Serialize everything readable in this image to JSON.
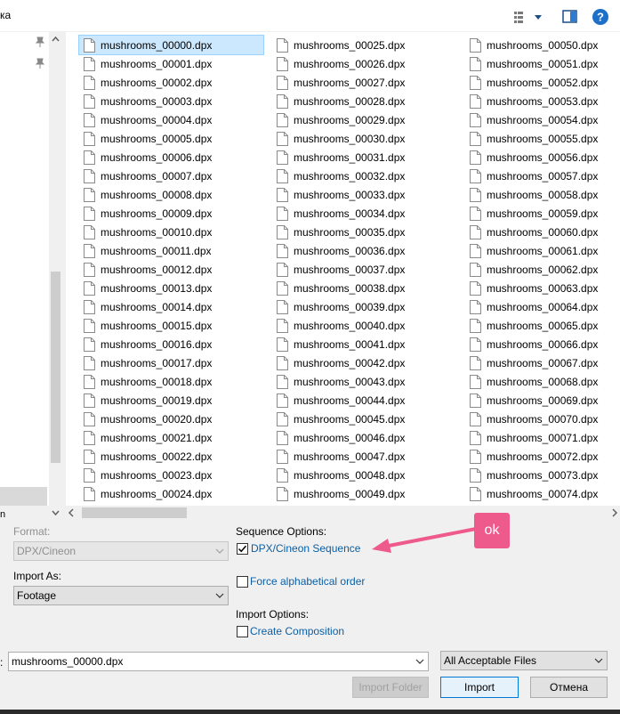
{
  "toolbar": {
    "crumb": "ка",
    "view_icon": "view-menu-icon",
    "pane_icon": "preview-pane-icon",
    "help_icon": "help-icon"
  },
  "nav": {
    "bottom_text": "n"
  },
  "files": [
    "mushrooms_00000.dpx",
    "mushrooms_00001.dpx",
    "mushrooms_00002.dpx",
    "mushrooms_00003.dpx",
    "mushrooms_00004.dpx",
    "mushrooms_00005.dpx",
    "mushrooms_00006.dpx",
    "mushrooms_00007.dpx",
    "mushrooms_00008.dpx",
    "mushrooms_00009.dpx",
    "mushrooms_00010.dpx",
    "mushrooms_00011.dpx",
    "mushrooms_00012.dpx",
    "mushrooms_00013.dpx",
    "mushrooms_00014.dpx",
    "mushrooms_00015.dpx",
    "mushrooms_00016.dpx",
    "mushrooms_00017.dpx",
    "mushrooms_00018.dpx",
    "mushrooms_00019.dpx",
    "mushrooms_00020.dpx",
    "mushrooms_00021.dpx",
    "mushrooms_00022.dpx",
    "mushrooms_00023.dpx",
    "mushrooms_00024.dpx",
    "mushrooms_00025.dpx",
    "mushrooms_00026.dpx",
    "mushrooms_00027.dpx",
    "mushrooms_00028.dpx",
    "mushrooms_00029.dpx",
    "mushrooms_00030.dpx",
    "mushrooms_00031.dpx",
    "mushrooms_00032.dpx",
    "mushrooms_00033.dpx",
    "mushrooms_00034.dpx",
    "mushrooms_00035.dpx",
    "mushrooms_00036.dpx",
    "mushrooms_00037.dpx",
    "mushrooms_00038.dpx",
    "mushrooms_00039.dpx",
    "mushrooms_00040.dpx",
    "mushrooms_00041.dpx",
    "mushrooms_00042.dpx",
    "mushrooms_00043.dpx",
    "mushrooms_00044.dpx",
    "mushrooms_00045.dpx",
    "mushrooms_00046.dpx",
    "mushrooms_00047.dpx",
    "mushrooms_00048.dpx",
    "mushrooms_00049.dpx",
    "mushrooms_00050.dpx",
    "mushrooms_00051.dpx",
    "mushrooms_00052.dpx",
    "mushrooms_00053.dpx",
    "mushrooms_00054.dpx",
    "mushrooms_00055.dpx",
    "mushrooms_00056.dpx",
    "mushrooms_00057.dpx",
    "mushrooms_00058.dpx",
    "mushrooms_00059.dpx",
    "mushrooms_00060.dpx",
    "mushrooms_00061.dpx",
    "mushrooms_00062.dpx",
    "mushrooms_00063.dpx",
    "mushrooms_00064.dpx",
    "mushrooms_00065.dpx",
    "mushrooms_00066.dpx",
    "mushrooms_00067.dpx",
    "mushrooms_00068.dpx",
    "mushrooms_00069.dpx",
    "mushrooms_00070.dpx",
    "mushrooms_00071.dpx",
    "mushrooms_00072.dpx",
    "mushrooms_00073.dpx",
    "mushrooms_00074.dpx"
  ],
  "selected_file": "mushrooms_00000.dpx",
  "options": {
    "format_label": "Format:",
    "format_value": "DPX/Cineon",
    "import_as_label": "Import As:",
    "import_as_value": "Footage",
    "sequence_options_label": "Sequence Options:",
    "dpx_sequence_label": "DPX/Cineon Sequence",
    "dpx_sequence_checked": true,
    "force_alpha_label": "Force alphabetical order",
    "force_alpha_checked": false,
    "import_options_label": "Import Options:",
    "create_comp_label": "Create Composition",
    "create_comp_checked": false
  },
  "annotation": {
    "bubble_text": "ok",
    "color": "#ef5a8c"
  },
  "filename": {
    "label": ":",
    "value": "mushrooms_00000.dpx"
  },
  "filter": {
    "value": "All Acceptable Files"
  },
  "buttons": {
    "import_folder": "Import Folder",
    "import": "Import",
    "cancel": "Отмена"
  }
}
